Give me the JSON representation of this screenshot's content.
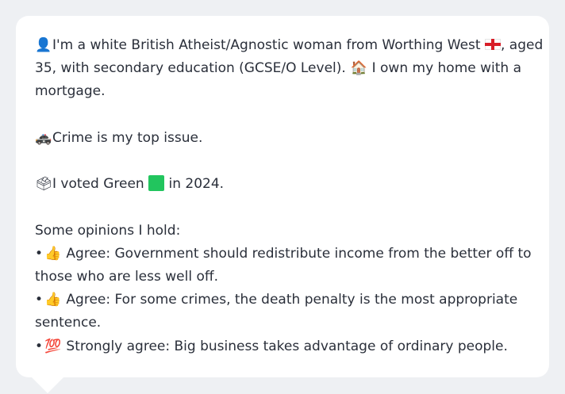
{
  "profile": {
    "line1a": "I'm a white British Atheist/Agnostic woman from Worthing West ",
    "line1b": ", aged",
    "line2": "35, with secondary education (GCSE/O Level).",
    "line2b": "I own my home with a",
    "line3": "mortgage.",
    "crime": "Crime is my top issue.",
    "vote_a": "I voted Green",
    "vote_b": "in 2024.",
    "opinions_header": "Some opinions I hold:",
    "op1a": "Agree: Government should redistribute income from the better off to",
    "op1b": "those who are less well off.",
    "op2a": "Agree: For some crimes, the death penalty is the most appropriate",
    "op2b": "sentence.",
    "op3": "Strongly agree: Big business takes advantage of ordinary people.",
    "bullet": "•"
  },
  "icons": {
    "person": "👤",
    "house": "🏠",
    "police_car": "🚓",
    "ballot": "🗳",
    "thumbs_up": "👍",
    "hundred": "💯"
  },
  "colors": {
    "card_bg": "#ffffff",
    "page_bg": "#eef0f3",
    "text": "#2a2f3a",
    "flag_red": "#d81e28",
    "green": "#22c55e"
  }
}
